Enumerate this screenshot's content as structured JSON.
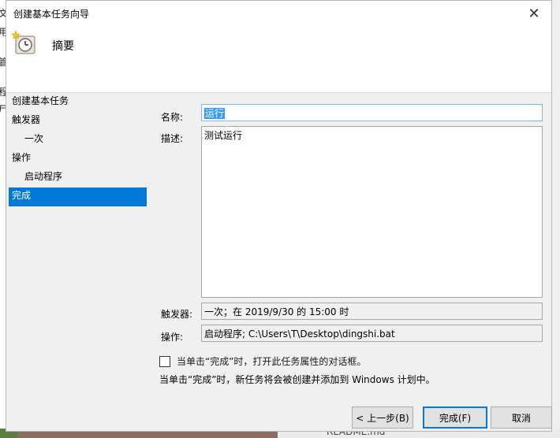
{
  "background": {
    "left_fragments": [
      "文",
      "用",
      "管",
      "程",
      "尸"
    ],
    "bottom_tab": "README.md"
  },
  "dialog": {
    "title": "创建基本任务向导",
    "header_title": "摘要",
    "close_glyph": "✕"
  },
  "nav": {
    "items": [
      {
        "label": "创建基本任务",
        "level": 0,
        "active": false
      },
      {
        "label": "触发器",
        "level": 0,
        "active": false
      },
      {
        "label": "一次",
        "level": 1,
        "active": false
      },
      {
        "label": "操作",
        "level": 0,
        "active": false
      },
      {
        "label": "启动程序",
        "level": 1,
        "active": false
      },
      {
        "label": "完成",
        "level": 0,
        "active": true
      }
    ]
  },
  "form": {
    "name_label": "名称:",
    "name_value": "运行",
    "desc_label": "描述:",
    "desc_value": "测试运行",
    "trigger_label": "触发器:",
    "trigger_value": "一次；在 2019/9/30 的 15:00 时",
    "action_label": "操作:",
    "action_value": "启动程序; C:\\Users\\T\\Desktop\\dingshi.bat",
    "checkbox_label": "当单击“完成”时，打开此任务属性的对话框。",
    "checkbox_checked": false,
    "info_text": "当单击“完成”时，新任务将会被创建并添加到 Windows 计划中。"
  },
  "buttons": {
    "back": "< 上一步(B)",
    "finish": "完成(F)",
    "cancel": "取消"
  },
  "colors": {
    "accent": "#0078d7",
    "selection": "#3399ff",
    "dialog_bg": "#f0f0f0"
  }
}
